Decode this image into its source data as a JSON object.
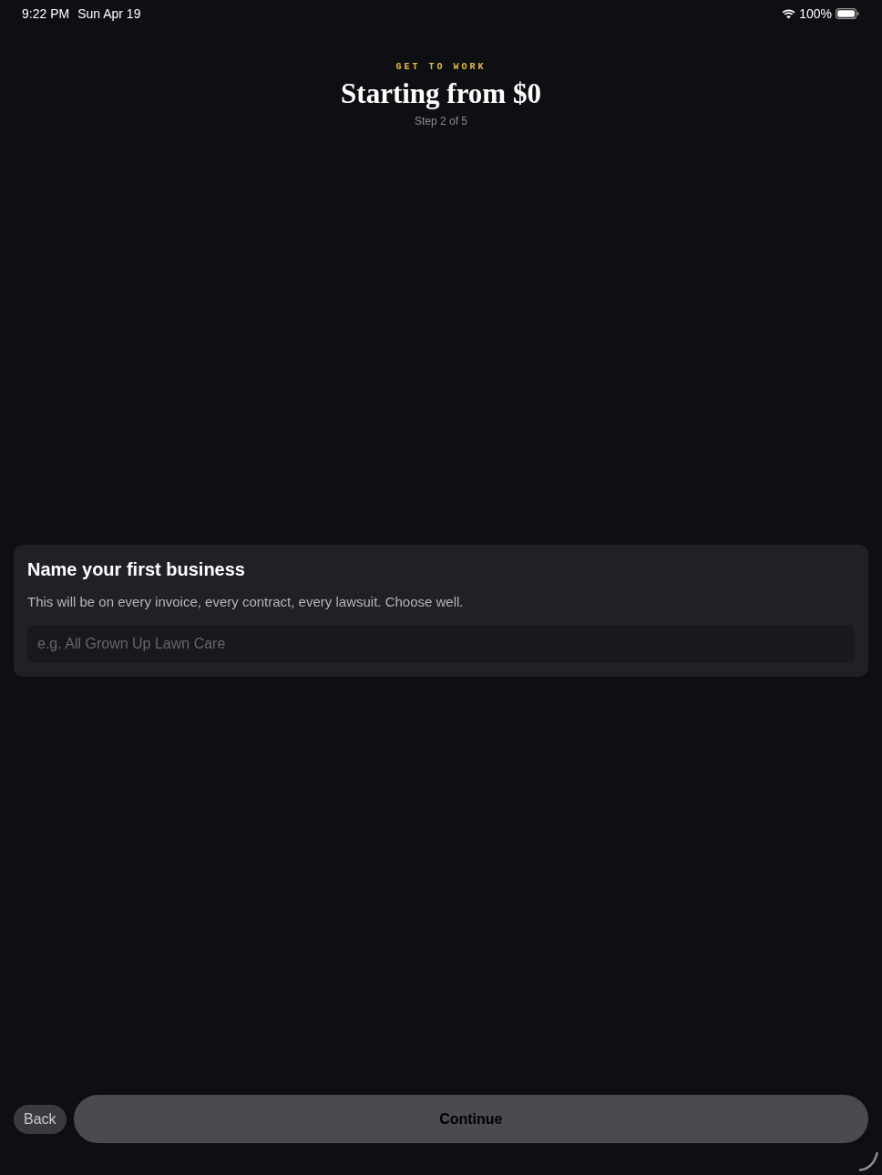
{
  "status_bar": {
    "time": "9:22 PM",
    "date": "Sun Apr 19",
    "battery": "100%"
  },
  "header": {
    "eyebrow": "GET TO WORK",
    "title": "Starting from $0",
    "step": "Step 2 of 5"
  },
  "card": {
    "title": "Name your first business",
    "description": "This will be on every invoice, every contract, every lawsuit. Choose well.",
    "input": {
      "placeholder": "e.g. All Grown Up Lawn Care"
    }
  },
  "footer": {
    "back_button": {
      "label": "Back"
    },
    "continue_button": {
      "label": "Continue",
      "disabled": true
    }
  }
}
